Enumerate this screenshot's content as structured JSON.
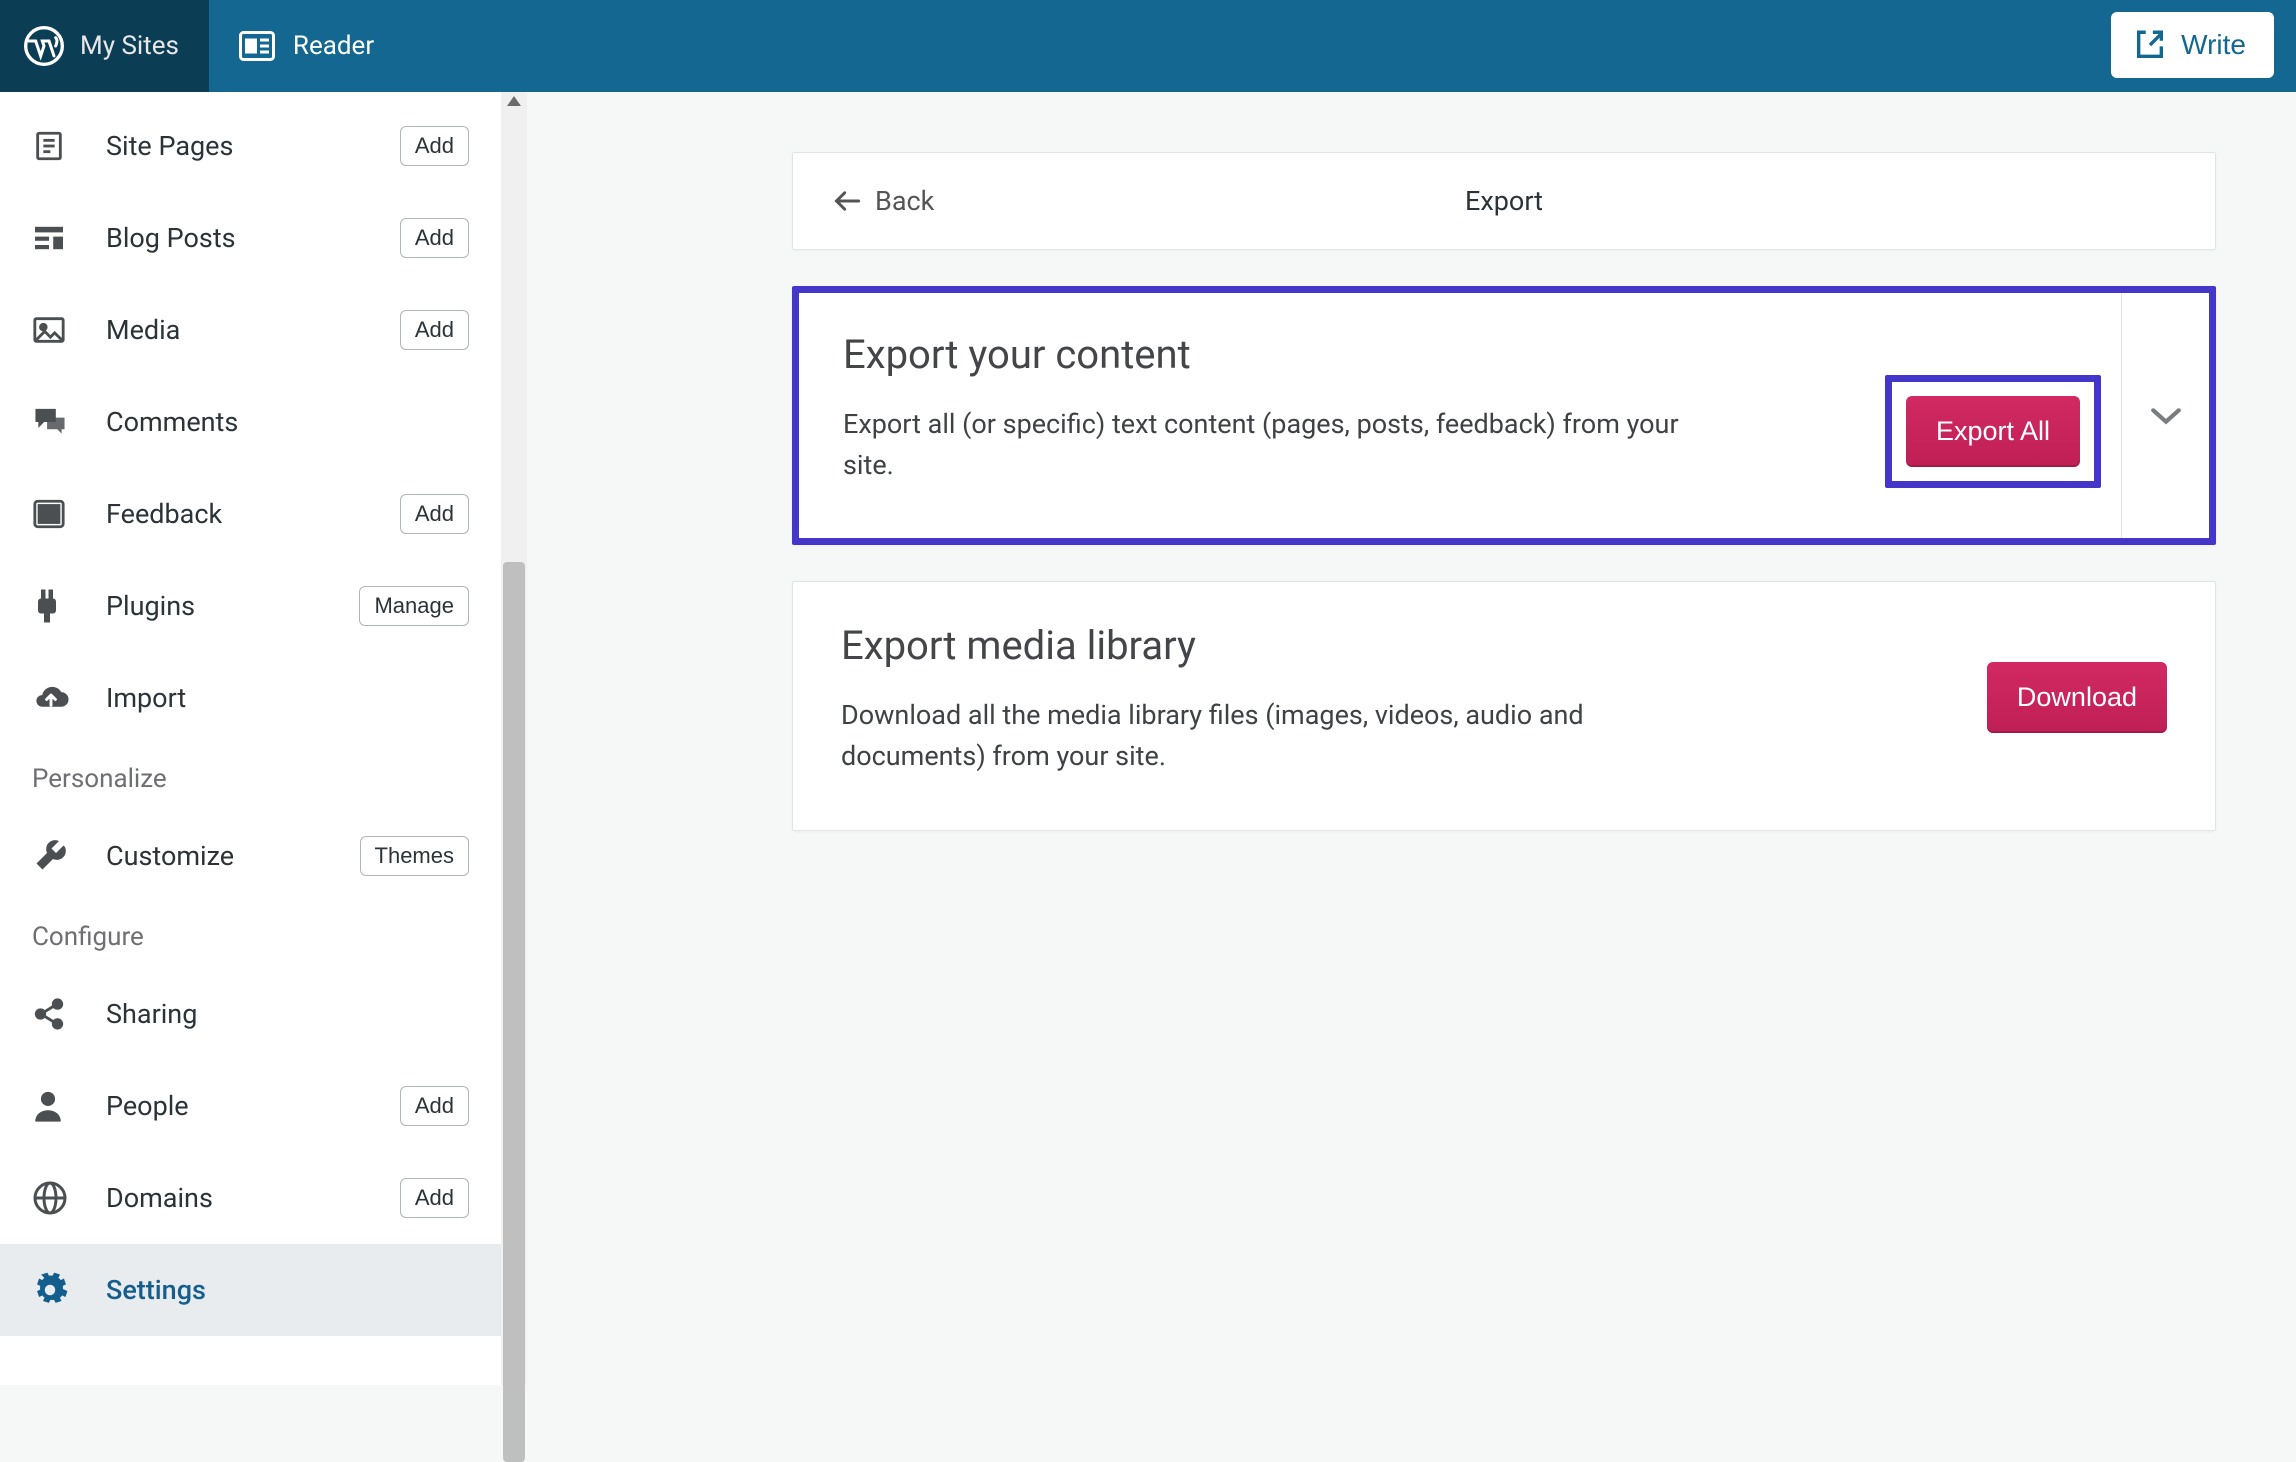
{
  "topbar": {
    "my_sites": "My Sites",
    "reader": "Reader",
    "write": "Write"
  },
  "sidebar": {
    "items": [
      {
        "label": "Site Pages",
        "icon": "page",
        "pill": "Add"
      },
      {
        "label": "Blog Posts",
        "icon": "posts",
        "pill": "Add"
      },
      {
        "label": "Media",
        "icon": "image",
        "pill": "Add"
      },
      {
        "label": "Comments",
        "icon": "comments",
        "pill": null
      },
      {
        "label": "Feedback",
        "icon": "feedback",
        "pill": "Add"
      },
      {
        "label": "Plugins",
        "icon": "plugin",
        "pill": "Manage"
      },
      {
        "label": "Import",
        "icon": "cloud-up",
        "pill": null
      }
    ],
    "personalize_heading": "Personalize",
    "personalize_items": [
      {
        "label": "Customize",
        "icon": "wrench",
        "pill": "Themes"
      }
    ],
    "configure_heading": "Configure",
    "configure_items": [
      {
        "label": "Sharing",
        "icon": "share",
        "pill": null
      },
      {
        "label": "People",
        "icon": "person",
        "pill": "Add"
      },
      {
        "label": "Domains",
        "icon": "globe",
        "pill": "Add"
      },
      {
        "label": "Settings",
        "icon": "gear",
        "pill": null,
        "active": true
      }
    ]
  },
  "main": {
    "back_label": "Back",
    "page_title": "Export",
    "export_content": {
      "title": "Export your content",
      "desc": "Export all (or specific) text content (pages, posts, feedback) from your site.",
      "button": "Export All"
    },
    "export_media": {
      "title": "Export media library",
      "desc": "Download all the media library files (images, videos, audio and documents) from your site.",
      "button": "Download"
    }
  }
}
